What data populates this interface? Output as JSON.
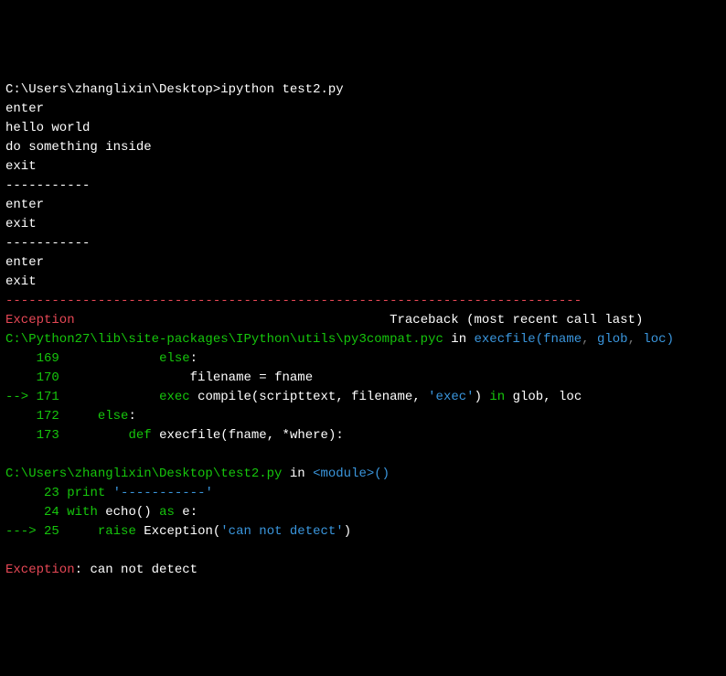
{
  "prompt": {
    "path": "C:\\Users\\zhanglixin\\Desktop>",
    "command": "ipython test2.py"
  },
  "stdout_lines": [
    "enter",
    "hello world",
    "do something inside",
    "exit",
    "-----------",
    "enter",
    "exit",
    "-----------",
    "enter",
    "exit"
  ],
  "tb_sep": "---------------------------------------------------------------------------",
  "tb_header": {
    "exc_name": "Exception",
    "spacer": "                                         ",
    "label": "Traceback (most recent call last)"
  },
  "frame1": {
    "path": "C:\\Python27\\lib\\site-packages\\IPython\\utils\\py3compat.pyc",
    "in": " in ",
    "func": "execfile",
    "sig_open": "(fname",
    "sig_sep1": ", ",
    "sig_glob": "glob",
    "sig_sep2": ", ",
    "sig_loc": "loc",
    "sig_close": ")",
    "lines": [
      {
        "num": "169",
        "arrow": "    ",
        "code_parts": [
          {
            "t": "            ",
            "c": "white"
          },
          {
            "t": "else",
            "c": "green"
          },
          {
            "t": ":",
            "c": "white"
          }
        ]
      },
      {
        "num": "170",
        "arrow": "    ",
        "code_parts": [
          {
            "t": "                filename ",
            "c": "white"
          },
          {
            "t": "=",
            "c": "white"
          },
          {
            "t": " fname",
            "c": "white"
          }
        ]
      },
      {
        "num": "171",
        "arrow": "--> ",
        "code_parts": [
          {
            "t": "            ",
            "c": "white"
          },
          {
            "t": "exec",
            "c": "green"
          },
          {
            "t": " compile",
            "c": "white"
          },
          {
            "t": "(",
            "c": "white"
          },
          {
            "t": "scripttext",
            "c": "white"
          },
          {
            "t": ",",
            "c": "white"
          },
          {
            "t": " filename",
            "c": "white"
          },
          {
            "t": ",",
            "c": "white"
          },
          {
            "t": " ",
            "c": "white"
          },
          {
            "t": "'exec'",
            "c": "cyan"
          },
          {
            "t": ")",
            "c": "white"
          },
          {
            "t": " ",
            "c": "white"
          },
          {
            "t": "in",
            "c": "green"
          },
          {
            "t": " glob",
            "c": "white"
          },
          {
            "t": ",",
            "c": "white"
          },
          {
            "t": " loc",
            "c": "white"
          }
        ]
      },
      {
        "num": "172",
        "arrow": "    ",
        "code_parts": [
          {
            "t": "    ",
            "c": "white"
          },
          {
            "t": "else",
            "c": "green"
          },
          {
            "t": ":",
            "c": "white"
          }
        ]
      },
      {
        "num": "173",
        "arrow": "    ",
        "code_parts": [
          {
            "t": "        ",
            "c": "white"
          },
          {
            "t": "def",
            "c": "green"
          },
          {
            "t": " execfile",
            "c": "white"
          },
          {
            "t": "(",
            "c": "white"
          },
          {
            "t": "fname",
            "c": "white"
          },
          {
            "t": ",",
            "c": "white"
          },
          {
            "t": " ",
            "c": "white"
          },
          {
            "t": "*",
            "c": "white"
          },
          {
            "t": "where",
            "c": "white"
          },
          {
            "t": ")",
            "c": "white"
          },
          {
            "t": ":",
            "c": "white"
          }
        ]
      }
    ]
  },
  "frame2": {
    "path": "C:\\Users\\zhanglixin\\Desktop\\test2.py",
    "in": " in ",
    "func": "<module>",
    "sig": "()",
    "lines": [
      {
        "num": "23",
        "arrow": "     ",
        "code_parts": [
          {
            "t": "print",
            "c": "green"
          },
          {
            "t": " ",
            "c": "white"
          },
          {
            "t": "'-----------'",
            "c": "cyan"
          }
        ]
      },
      {
        "num": "24",
        "arrow": "     ",
        "code_parts": [
          {
            "t": "with",
            "c": "green"
          },
          {
            "t": " echo",
            "c": "white"
          },
          {
            "t": "()",
            "c": "white"
          },
          {
            "t": " ",
            "c": "white"
          },
          {
            "t": "as",
            "c": "green"
          },
          {
            "t": " e",
            "c": "white"
          },
          {
            "t": ":",
            "c": "white"
          }
        ]
      },
      {
        "num": "25",
        "arrow": "---> ",
        "code_parts": [
          {
            "t": "    ",
            "c": "white"
          },
          {
            "t": "raise",
            "c": "green"
          },
          {
            "t": " Exception",
            "c": "white"
          },
          {
            "t": "(",
            "c": "white"
          },
          {
            "t": "'can not detect'",
            "c": "cyan"
          },
          {
            "t": ")",
            "c": "white"
          }
        ]
      }
    ]
  },
  "final_exc": {
    "name": "Exception",
    "sep": ": ",
    "msg": "can not detect"
  }
}
